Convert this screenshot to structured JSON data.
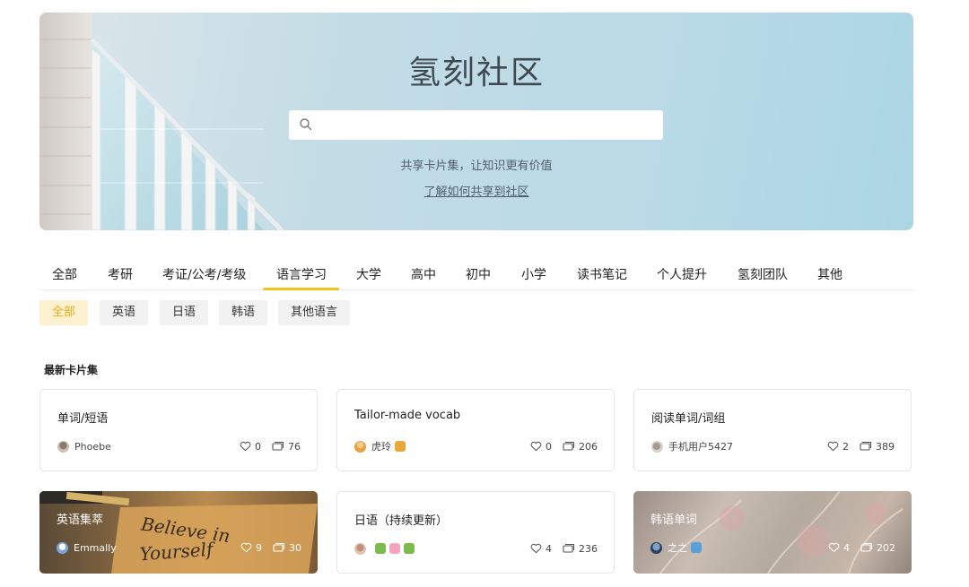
{
  "hero": {
    "title": "氢刻社区",
    "search_placeholder": "",
    "subtitle": "共享卡片集，让知识更有价值",
    "link": "了解如何共享到社区"
  },
  "tabs": [
    "全部",
    "考研",
    "考证/公考/考级",
    "语言学习",
    "大学",
    "高中",
    "初中",
    "小学",
    "读书笔记",
    "个人提升",
    "氢刻团队",
    "其他"
  ],
  "active_tab": "语言学习",
  "subfilters": [
    "全部",
    "英语",
    "日语",
    "韩语",
    "其他语言"
  ],
  "active_subfilter": "全部",
  "section_title": "最新卡片集",
  "cards": [
    {
      "title": "单词/短语",
      "author": "Phoebe",
      "likes": "0",
      "cards": "76"
    },
    {
      "title": "Tailor-made vocab",
      "author": "虎玲",
      "likes": "0",
      "cards": "206"
    },
    {
      "title": "阅读单词/词组",
      "author": "手机用户5427",
      "likes": "2",
      "cards": "389"
    },
    {
      "title": "英语集萃",
      "author": "Emmally",
      "likes": "9",
      "cards": "30",
      "image_text_1": "Believe in",
      "image_text_2": "Yourself"
    },
    {
      "title": "日语（持续更新）",
      "author": "",
      "likes": "4",
      "cards": "236"
    },
    {
      "title": "韩语单词",
      "author": "之之",
      "likes": "4",
      "cards": "202"
    }
  ],
  "colors": {
    "accent": "#f4c21b",
    "chip_active_bg": "#fdf1cf",
    "chip_active_text": "#f1a91b"
  }
}
